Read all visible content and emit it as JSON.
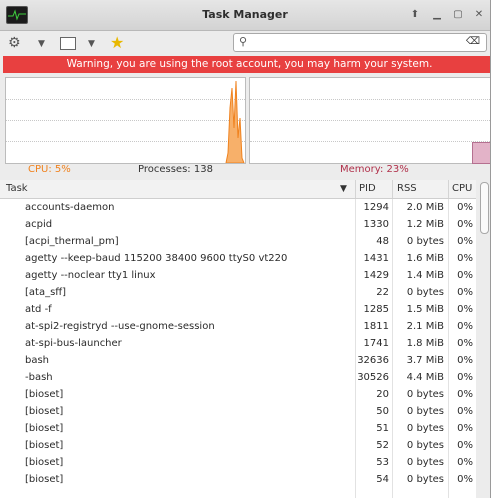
{
  "window": {
    "title": "Task Manager"
  },
  "toolbar": {
    "settings_icon": "gears-icon",
    "view_icon": "window-view-icon",
    "favorite_icon": "star-icon",
    "search": {
      "value": "",
      "placeholder": ""
    }
  },
  "warning": {
    "text": "Warning, you are using the root account, you may harm your system.",
    "color": "#e84040"
  },
  "summary": {
    "cpu": "CPU: 5%",
    "processes": "Processes: 138",
    "memory": "Memory: 23%"
  },
  "colors": {
    "cpu": "#f0821e",
    "memory": "#d9a3b8"
  },
  "graphs": {
    "cpu_percent": 5,
    "memory_percent": 23
  },
  "table": {
    "columns": [
      "Task",
      "PID",
      "RSS",
      "CPU"
    ],
    "rows": [
      {
        "task": "accounts-daemon",
        "pid": "1294",
        "rss": "2.0 MiB",
        "cpu": "0%"
      },
      {
        "task": "acpid",
        "pid": "1330",
        "rss": "1.2 MiB",
        "cpu": "0%"
      },
      {
        "task": "[acpi_thermal_pm]",
        "pid": "48",
        "rss": "0 bytes",
        "cpu": "0%"
      },
      {
        "task": "agetty --keep-baud 115200 38400 9600 ttyS0 vt220",
        "pid": "1431",
        "rss": "1.6 MiB",
        "cpu": "0%"
      },
      {
        "task": "agetty --noclear tty1 linux",
        "pid": "1429",
        "rss": "1.4 MiB",
        "cpu": "0%"
      },
      {
        "task": "[ata_sff]",
        "pid": "22",
        "rss": "0 bytes",
        "cpu": "0%"
      },
      {
        "task": "atd -f",
        "pid": "1285",
        "rss": "1.5 MiB",
        "cpu": "0%"
      },
      {
        "task": "at-spi2-registryd --use-gnome-session",
        "pid": "1811",
        "rss": "2.1 MiB",
        "cpu": "0%"
      },
      {
        "task": "at-spi-bus-launcher",
        "pid": "1741",
        "rss": "1.8 MiB",
        "cpu": "0%"
      },
      {
        "task": "bash",
        "pid": "32636",
        "rss": "3.7 MiB",
        "cpu": "0%"
      },
      {
        "task": "-bash",
        "pid": "30526",
        "rss": "4.4 MiB",
        "cpu": "0%"
      },
      {
        "task": "[bioset]",
        "pid": "20",
        "rss": "0 bytes",
        "cpu": "0%"
      },
      {
        "task": "[bioset]",
        "pid": "50",
        "rss": "0 bytes",
        "cpu": "0%"
      },
      {
        "task": "[bioset]",
        "pid": "51",
        "rss": "0 bytes",
        "cpu": "0%"
      },
      {
        "task": "[bioset]",
        "pid": "52",
        "rss": "0 bytes",
        "cpu": "0%"
      },
      {
        "task": "[bioset]",
        "pid": "53",
        "rss": "0 bytes",
        "cpu": "0%"
      },
      {
        "task": "[bioset]",
        "pid": "54",
        "rss": "0 bytes",
        "cpu": "0%"
      }
    ]
  }
}
